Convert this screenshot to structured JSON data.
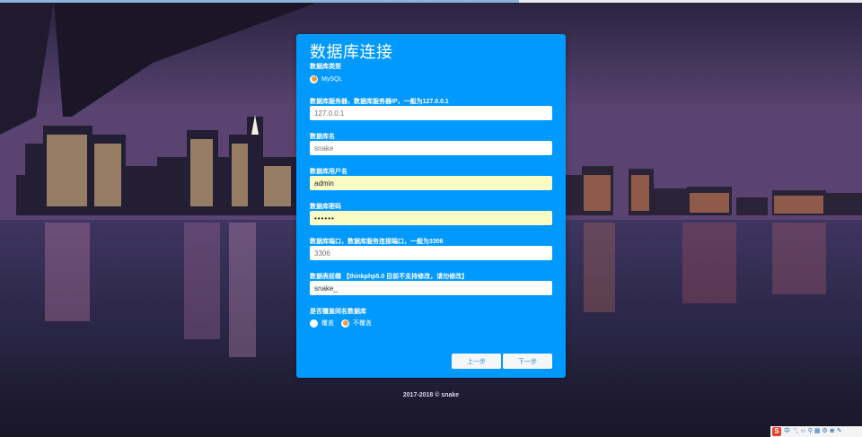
{
  "form": {
    "title": "数据库连接",
    "db_type": {
      "label": "数据库类型",
      "options": [
        {
          "label": "MySQL",
          "selected": true
        }
      ]
    },
    "host": {
      "label": "数据库服务器，数据库服务器IP，一般为127.0.0.1",
      "value": "",
      "placeholder": "127.0.0.1"
    },
    "name": {
      "label": "数据库名",
      "value": "",
      "placeholder": "snake"
    },
    "user": {
      "label": "数据库用户名",
      "value": "admin"
    },
    "password": {
      "label": "数据库密码",
      "value": "••••••"
    },
    "port": {
      "label": "数据库端口，数据库服务连接端口，一般为3306",
      "value": "",
      "placeholder": "3306"
    },
    "prefix": {
      "label": "数据表前缀 【thinkphp5.0 目前不支持修改，请勿修改】",
      "value": "snake_"
    },
    "overwrite": {
      "label": "是否覆盖同名数据库",
      "options": [
        {
          "label": "覆盖",
          "selected": false
        },
        {
          "label": "不覆盖",
          "selected": true
        }
      ]
    },
    "prev_label": "上一步",
    "next_label": "下一步"
  },
  "footer": {
    "copyright": "2017-2018 © snake"
  },
  "tray": {
    "ime_label": "中",
    "extras": "°, ☺ ⚲ ▦ ⚙ ♚ ✎"
  },
  "colors": {
    "panel": "#0099ff",
    "radio_on": "#f29a38",
    "autofill": "#fbfbc6"
  }
}
